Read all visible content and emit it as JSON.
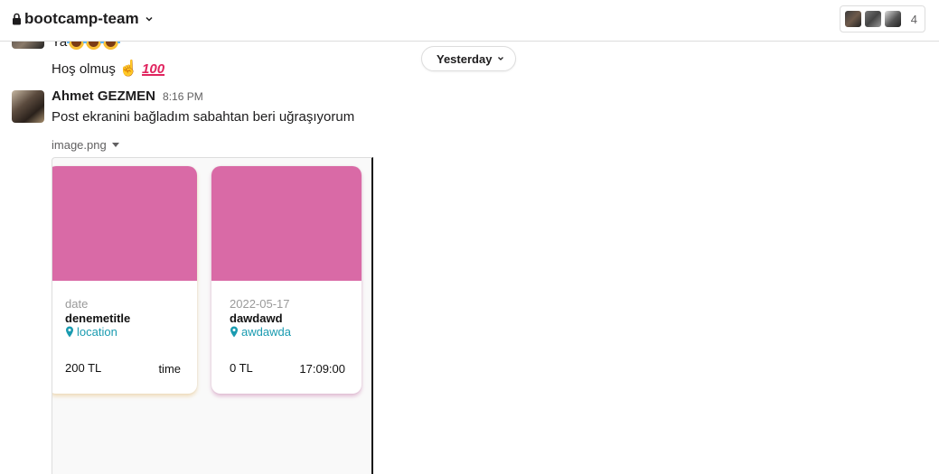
{
  "header": {
    "channel_name": "bootcamp-team",
    "member_count": "4",
    "icons": [
      "lock-icon",
      "chevron-down-icon"
    ]
  },
  "messages": {
    "previous": {
      "line1_text": "Ya",
      "line1_emojis": [
        "laughing-tears-emoji",
        "laughing-tears-emoji",
        "laughing-tears-emoji"
      ],
      "line2_text": "Hoş olmuş",
      "line2_emojis": [
        "ok-hand-emoji",
        "hundred-points-emoji"
      ]
    },
    "date_divider": "Yesterday",
    "current": {
      "sender": "Ahmet GEZMEN",
      "time": "8:16 PM",
      "text": "Post ekranini bağladım sabahtan beri uğraşıyorum",
      "attachment": {
        "filename": "image.png",
        "cards": [
          {
            "date": "date",
            "title": "denemetitle",
            "location": "location",
            "price": "200 TL",
            "time": "time",
            "image_color": "#d96aa6"
          },
          {
            "date": "2022-05-17",
            "title": "dawdawd",
            "location": "awdawda",
            "price": "0 TL",
            "time": "17:09:00",
            "image_color": "#d96aa6"
          }
        ]
      }
    }
  },
  "colors": {
    "link_teal": "#1a9bb0",
    "card_pink": "#d96aa6"
  }
}
